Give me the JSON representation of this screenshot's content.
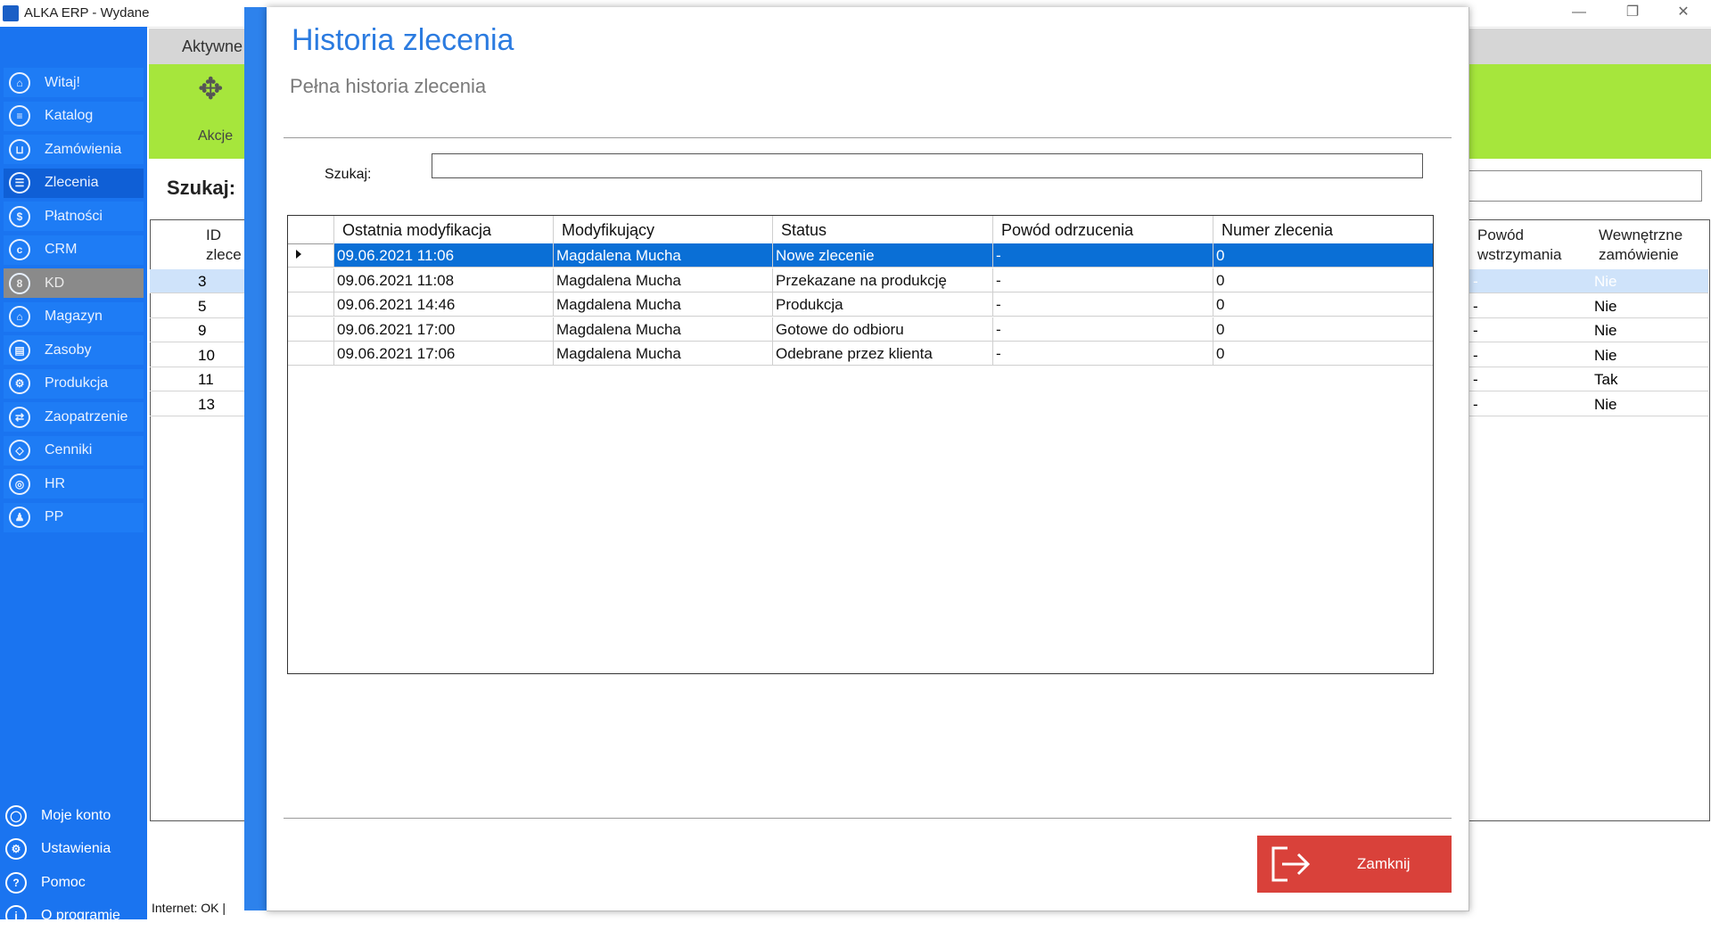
{
  "window": {
    "title": "ALKA ERP - Wydane",
    "controls": {
      "minimize": "—",
      "restore": "❐",
      "close": "✕"
    }
  },
  "sidebar": {
    "items": [
      {
        "label": "Witaj!",
        "icon": "home-icon",
        "glyph": "⌂"
      },
      {
        "label": "Katalog",
        "icon": "book-icon",
        "glyph": "≡"
      },
      {
        "label": "Zamówienia",
        "icon": "cart-icon",
        "glyph": "⊔"
      },
      {
        "label": "Zlecenia",
        "icon": "list-icon",
        "glyph": "☰"
      },
      {
        "label": "Płatności",
        "icon": "dollar-icon",
        "glyph": "$"
      },
      {
        "label": "CRM",
        "icon": "crm-icon",
        "glyph": "c"
      },
      {
        "label": "KD",
        "icon": "person-icon",
        "glyph": "8"
      },
      {
        "label": "Magazyn",
        "icon": "warehouse-icon",
        "glyph": "⌂"
      },
      {
        "label": "Zasoby",
        "icon": "resources-icon",
        "glyph": "▤"
      },
      {
        "label": "Produkcja",
        "icon": "production-icon",
        "glyph": "⚙"
      },
      {
        "label": "Zaopatrzenie",
        "icon": "supply-truck-icon",
        "glyph": "⇄"
      },
      {
        "label": "Cenniki",
        "icon": "tag-icon",
        "glyph": "◇"
      },
      {
        "label": "HR",
        "icon": "hr-icon",
        "glyph": "◎"
      },
      {
        "label": "PP",
        "icon": "pp-icon",
        "glyph": "♟"
      }
    ],
    "bottom": [
      {
        "label": "Moje konto",
        "icon": "user-icon",
        "glyph": "◯"
      },
      {
        "label": "Ustawienia",
        "icon": "settings-icon",
        "glyph": "⚙"
      },
      {
        "label": "Pomoc",
        "icon": "help-icon",
        "glyph": "?"
      },
      {
        "label": "O programie",
        "icon": "info-icon",
        "glyph": "i"
      }
    ]
  },
  "background": {
    "tab_label": "Aktywne",
    "ribbon_action_label": "Akcje",
    "search_label": "Szukaj:",
    "grid": {
      "header_id": "ID\nzlece",
      "header_pause": "Powód\nwstrzymania",
      "header_internal": "Wewnętrzne\nzamówienie",
      "rows": [
        {
          "id": "3",
          "pause": "-",
          "internal": "Nie"
        },
        {
          "id": "5",
          "pause": "-",
          "internal": "Nie"
        },
        {
          "id": "9",
          "pause": "-",
          "internal": "Nie"
        },
        {
          "id": "10",
          "pause": "-",
          "internal": "Nie"
        },
        {
          "id": "11",
          "pause": "-",
          "internal": "Tak"
        },
        {
          "id": "13",
          "pause": "-",
          "internal": "Nie"
        }
      ]
    },
    "status": "Internet: OK  |"
  },
  "modal": {
    "title": "Historia zlecenia",
    "subtitle": "Pełna historia zlecenia",
    "search_label": "Szukaj:",
    "search_value": "",
    "columns": [
      "Ostatnia modyfikacja",
      "Modyfikujący",
      "Status",
      "Powód odrzucenia",
      "Numer zlecenia"
    ],
    "rows": [
      {
        "modified": "09.06.2021 11:06",
        "user": "Magdalena Mucha",
        "status": "Nowe zlecenie",
        "reason": "-",
        "number": "0"
      },
      {
        "modified": "09.06.2021 11:08",
        "user": "Magdalena Mucha",
        "status": "Przekazane na produkcję",
        "reason": "-",
        "number": "0"
      },
      {
        "modified": "09.06.2021 14:46",
        "user": "Magdalena Mucha",
        "status": "Produkcja",
        "reason": "-",
        "number": "0"
      },
      {
        "modified": "09.06.2021 17:00",
        "user": "Magdalena Mucha",
        "status": "Gotowe do odbioru",
        "reason": "-",
        "number": "0"
      },
      {
        "modified": "09.06.2021 17:06",
        "user": "Magdalena Mucha",
        "status": "Odebrane przez klienta",
        "reason": "-",
        "number": "0"
      }
    ],
    "close_label": "Zamknij",
    "colors": {
      "accent": "#2d82ec",
      "selection": "#0a6fd6",
      "close": "#d9413a"
    }
  }
}
